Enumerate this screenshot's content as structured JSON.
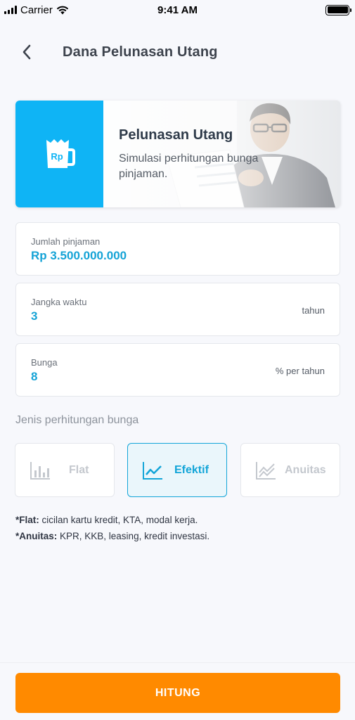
{
  "status_bar": {
    "carrier": "Carrier",
    "time": "9:41 AM"
  },
  "nav": {
    "title": "Dana Pelunasan Utang"
  },
  "banner": {
    "icon_text": "Rp",
    "title": "Pelunasan Utang",
    "subtitle": "Simulasi perhitungan bunga pinjaman."
  },
  "fields": {
    "loan": {
      "label": "Jumlah pinjaman",
      "value": "Rp 3.500.000.000"
    },
    "term": {
      "label": "Jangka waktu",
      "value": "3",
      "unit": "tahun"
    },
    "interest": {
      "label": "Bunga",
      "value": "8",
      "unit": "% per tahun"
    }
  },
  "interest_type": {
    "section_label": "Jenis perhitungan bunga",
    "options": [
      {
        "label": "Flat",
        "icon": "bar-chart-icon",
        "selected": false
      },
      {
        "label": "Efektif",
        "icon": "line-chart-icon",
        "selected": true
      },
      {
        "label": "Anuitas",
        "icon": "area-chart-icon",
        "selected": false
      }
    ]
  },
  "notes": [
    {
      "term": "*Flat:",
      "text": " cicilan kartu kredit, KTA, modal kerja."
    },
    {
      "term": "*Anuitas:",
      "text": " KPR, KKB, leasing, kredit investasi."
    }
  ],
  "cta": {
    "label": "HITUNG"
  },
  "colors": {
    "accent": "#13a5d8",
    "banner_blue": "#0fb4f5",
    "cta_orange": "#ff8a00"
  }
}
